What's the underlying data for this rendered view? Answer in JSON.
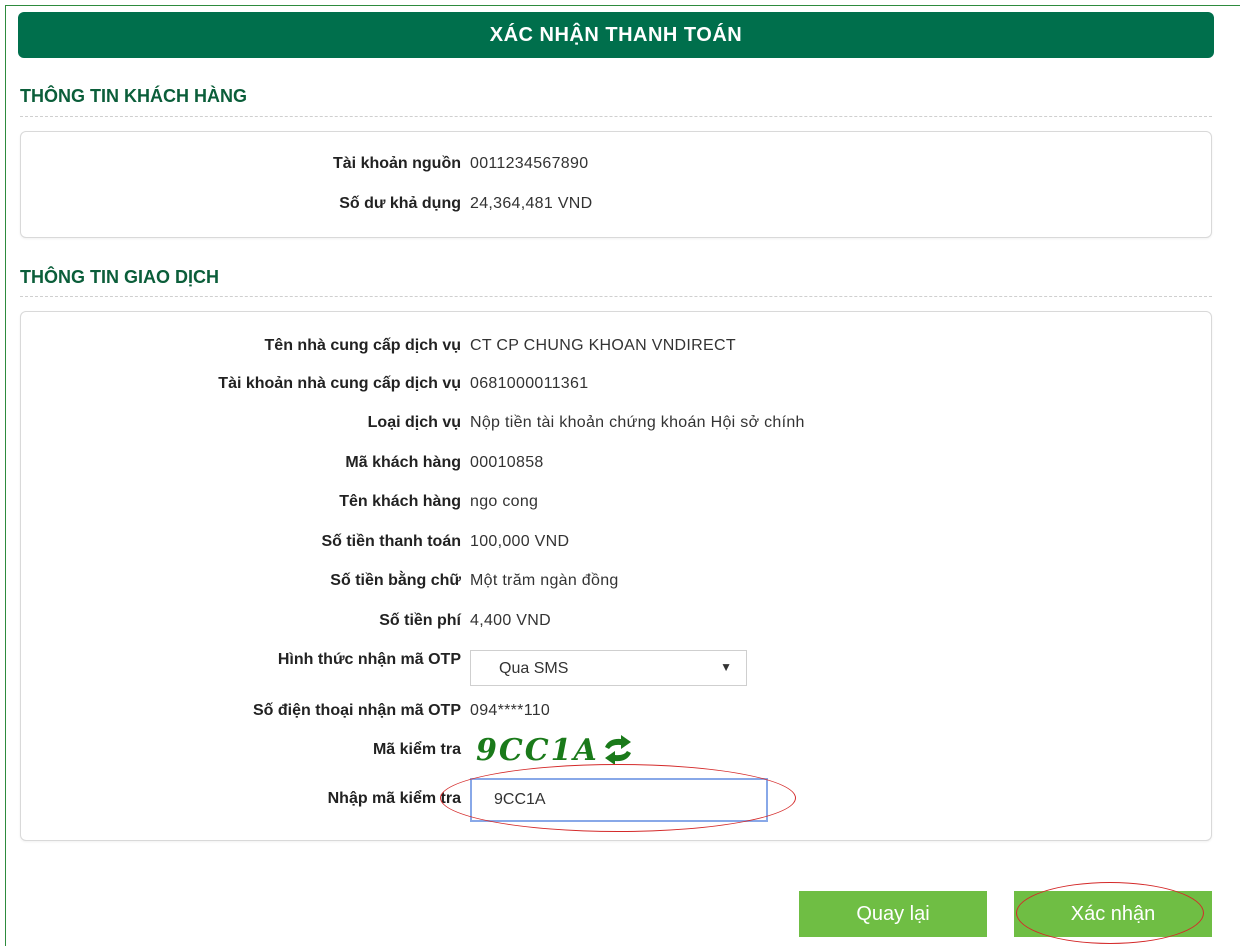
{
  "page": {
    "title": "XÁC NHẬN THANH TOÁN"
  },
  "customer_section": {
    "heading": "THÔNG TIN KHÁCH HÀNG",
    "rows": [
      {
        "label": "Tài khoản nguồn",
        "value": "0011234567890"
      },
      {
        "label": "Số dư khả dụng",
        "value": "24,364,481 VND"
      }
    ]
  },
  "transaction_section": {
    "heading": "THÔNG TIN GIAO DỊCH",
    "rows": [
      {
        "label": "Tên nhà cung cấp dịch vụ",
        "value": "CT CP CHUNG KHOAN VNDIRECT"
      },
      {
        "label": "Tài khoản nhà cung cấp dịch vụ",
        "value": "0681000011361"
      },
      {
        "label": "Loại dịch vụ",
        "value": "Nộp tiền tài khoản chứng khoán Hội sở chính"
      },
      {
        "label": "Mã khách hàng",
        "value": "00010858"
      },
      {
        "label": "Tên khách hàng",
        "value": "ngo cong"
      },
      {
        "label": "Số tiền thanh toán",
        "value": "100,000 VND"
      },
      {
        "label": "Số tiền bằng chữ",
        "value": "Một trăm ngàn đồng"
      },
      {
        "label": "Số tiền phí",
        "value": "4,400 VND"
      }
    ],
    "otp_method": {
      "label": "Hình thức nhận mã OTP",
      "selected": "Qua SMS"
    },
    "otp_phone": {
      "label": "Số điện thoại nhận mã OTP",
      "value": "094****110"
    },
    "captcha": {
      "label": "Mã kiểm tra",
      "value": "9CC1A",
      "icon": "refresh-icon"
    },
    "captcha_input": {
      "label": "Nhập mã kiểm tra",
      "value": "9CC1A"
    }
  },
  "buttons": {
    "back": "Quay lại",
    "confirm": "Xác nhận"
  },
  "colors": {
    "header_bg": "#006f4c",
    "heading_text": "#0b5e3a",
    "button_bg": "#6fbe44",
    "annotation": "#d42a2a"
  }
}
